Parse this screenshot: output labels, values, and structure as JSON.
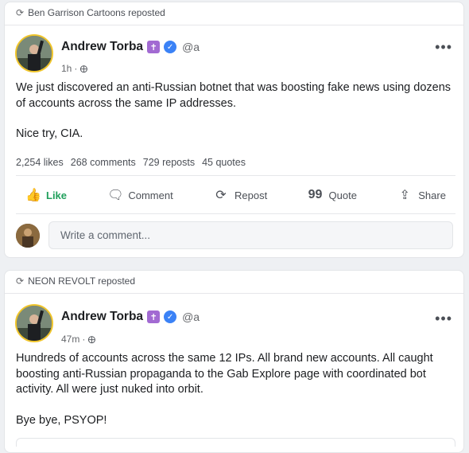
{
  "posts": [
    {
      "reposted_by": "Ben Garrison Cartoons reposted",
      "author": "Andrew Torba",
      "handle": "@a",
      "time": "1h",
      "paragraphs": [
        "We just discovered an anti-Russian botnet that was boosting fake news using dozens of accounts across the same IP addresses.",
        "Nice try, CIA."
      ],
      "stats": {
        "likes": "2,254 likes",
        "comments": "268 comments",
        "reposts": "729 reposts",
        "quotes": "45 quotes"
      },
      "actions": {
        "like": "Like",
        "comment": "Comment",
        "repost": "Repost",
        "quote": "Quote",
        "share": "Share"
      },
      "comment_placeholder": "Write a comment..."
    },
    {
      "reposted_by": "NEON REVOLT reposted",
      "author": "Andrew Torba",
      "handle": "@a",
      "time": "47m",
      "paragraphs": [
        "Hundreds of accounts across the same 12 IPs. All brand new accounts. All caught boosting anti-Russian propaganda to the Gab Explore page with coordinated bot activity. All were just nuked into orbit.",
        "Bye bye, PSYOP!"
      ]
    }
  ],
  "colors": {
    "like_green": "#21a05c",
    "avatar_ring": "#f0c52b",
    "verified_blue": "#3b82f6",
    "cross_badge_purple": "#a26ad2"
  },
  "icons": [
    "repost-icon",
    "globe-icon",
    "more-icon",
    "like-icon",
    "comment-icon",
    "repost-action-icon",
    "quote-icon",
    "share-icon",
    "verified-icon",
    "cross-badge-icon"
  ]
}
